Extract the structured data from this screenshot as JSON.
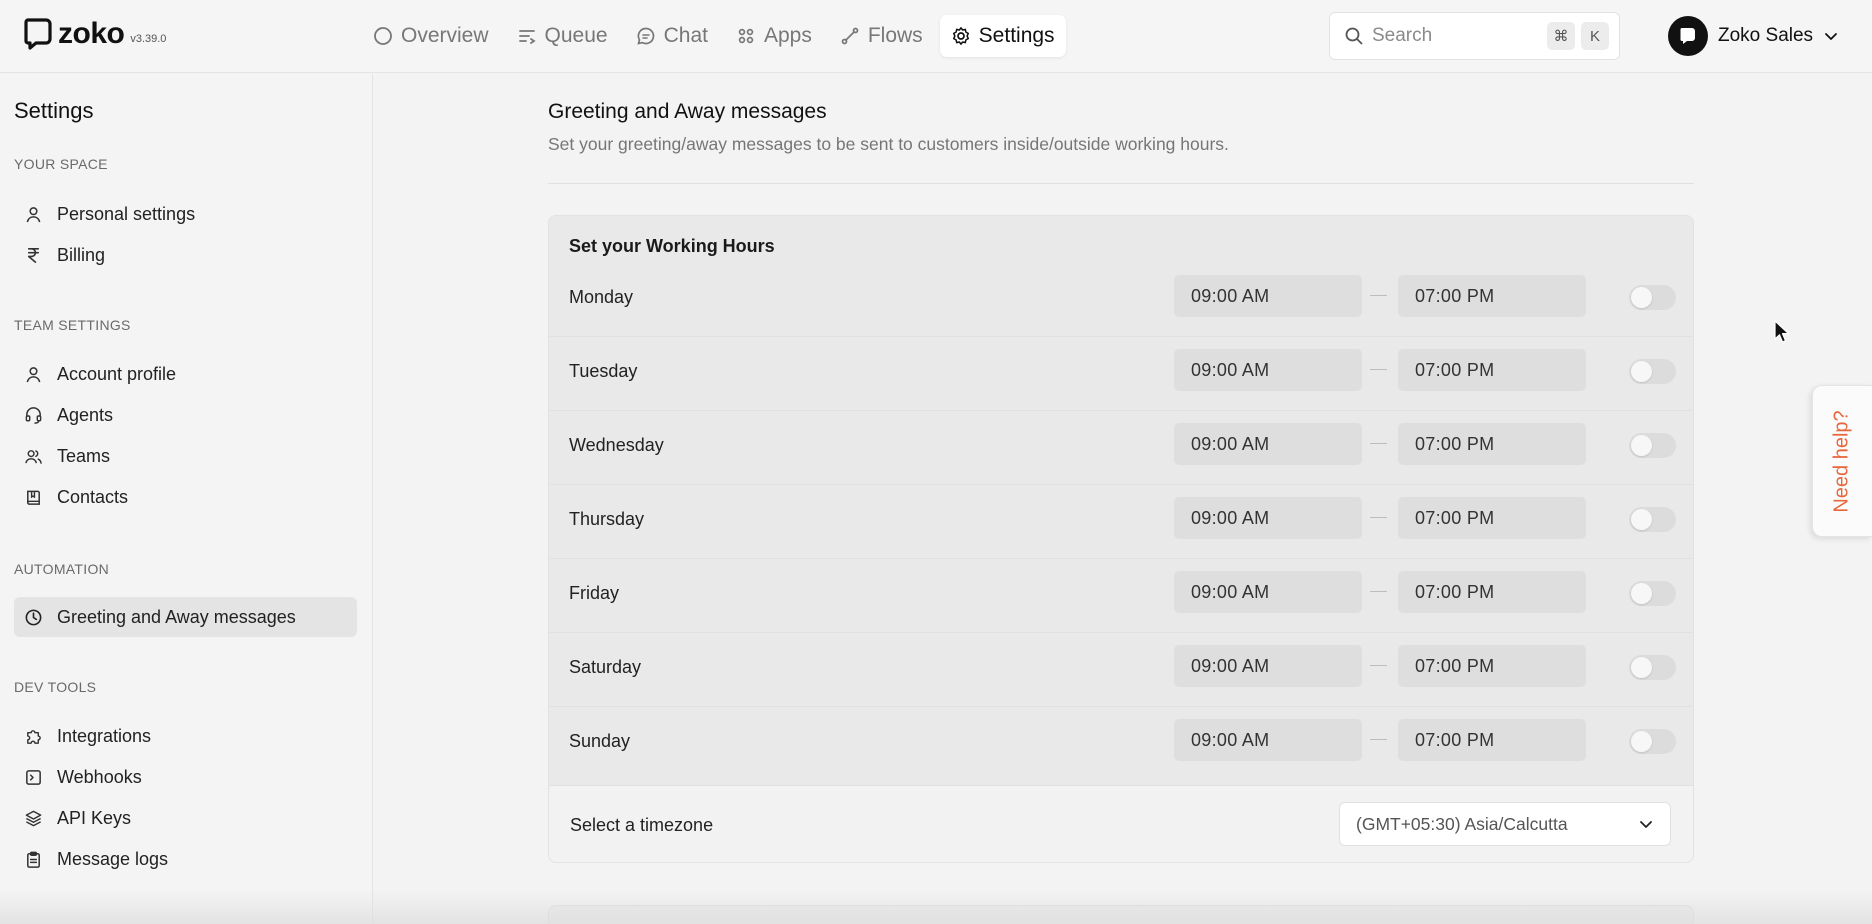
{
  "brand": {
    "name": "zoko",
    "version": "v3.39.0"
  },
  "nav": [
    {
      "label": "Overview",
      "icon": "circle-icon"
    },
    {
      "label": "Queue",
      "icon": "queue-icon"
    },
    {
      "label": "Chat",
      "icon": "chat-icon"
    },
    {
      "label": "Apps",
      "icon": "apps-icon"
    },
    {
      "label": "Flows",
      "icon": "flows-icon"
    },
    {
      "label": "Settings",
      "icon": "gear-icon",
      "active": true
    }
  ],
  "search": {
    "placeholder": "Search",
    "shortcut_mod": "⌘",
    "shortcut_key": "K"
  },
  "account": {
    "name": "Zoko Sales"
  },
  "sidebar": {
    "title": "Settings",
    "sections": [
      {
        "label": "YOUR SPACE",
        "items": [
          {
            "label": "Personal settings",
            "icon": "user-icon"
          },
          {
            "label": "Billing",
            "icon": "rupee-icon"
          }
        ]
      },
      {
        "label": "TEAM SETTINGS",
        "items": [
          {
            "label": "Account profile",
            "icon": "user-icon"
          },
          {
            "label": "Agents",
            "icon": "headset-icon"
          },
          {
            "label": "Teams",
            "icon": "users-icon"
          },
          {
            "label": "Contacts",
            "icon": "book-icon"
          }
        ]
      },
      {
        "label": "AUTOMATION",
        "items": [
          {
            "label": "Greeting and Away messages",
            "icon": "clock-icon",
            "active": true
          }
        ]
      },
      {
        "label": "DEV TOOLS",
        "items": [
          {
            "label": "Integrations",
            "icon": "puzzle-icon"
          },
          {
            "label": "Webhooks",
            "icon": "terminal-icon"
          },
          {
            "label": "API Keys",
            "icon": "layers-icon"
          },
          {
            "label": "Message logs",
            "icon": "clipboard-icon"
          }
        ]
      }
    ]
  },
  "main": {
    "title": "Greeting and Away messages",
    "subtitle": "Set your greeting/away messages to be sent to customers inside/outside working hours.",
    "working_hours": {
      "title": "Set your Working Hours",
      "days": [
        {
          "day": "Monday",
          "start": "09:00 AM",
          "end": "07:00 PM",
          "enabled": false
        },
        {
          "day": "Tuesday",
          "start": "09:00 AM",
          "end": "07:00 PM",
          "enabled": false
        },
        {
          "day": "Wednesday",
          "start": "09:00 AM",
          "end": "07:00 PM",
          "enabled": false
        },
        {
          "day": "Thursday",
          "start": "09:00 AM",
          "end": "07:00 PM",
          "enabled": false
        },
        {
          "day": "Friday",
          "start": "09:00 AM",
          "end": "07:00 PM",
          "enabled": false
        },
        {
          "day": "Saturday",
          "start": "09:00 AM",
          "end": "07:00 PM",
          "enabled": false
        },
        {
          "day": "Sunday",
          "start": "09:00 AM",
          "end": "07:00 PM",
          "enabled": false
        }
      ],
      "timezone_label": "Select a timezone",
      "timezone_value": "(GMT+05:30) Asia/Calcutta"
    }
  },
  "help": {
    "label": "Need help?"
  },
  "colors": {
    "help_accent": "#e8663c",
    "active_bg": "#e4e4e4"
  }
}
